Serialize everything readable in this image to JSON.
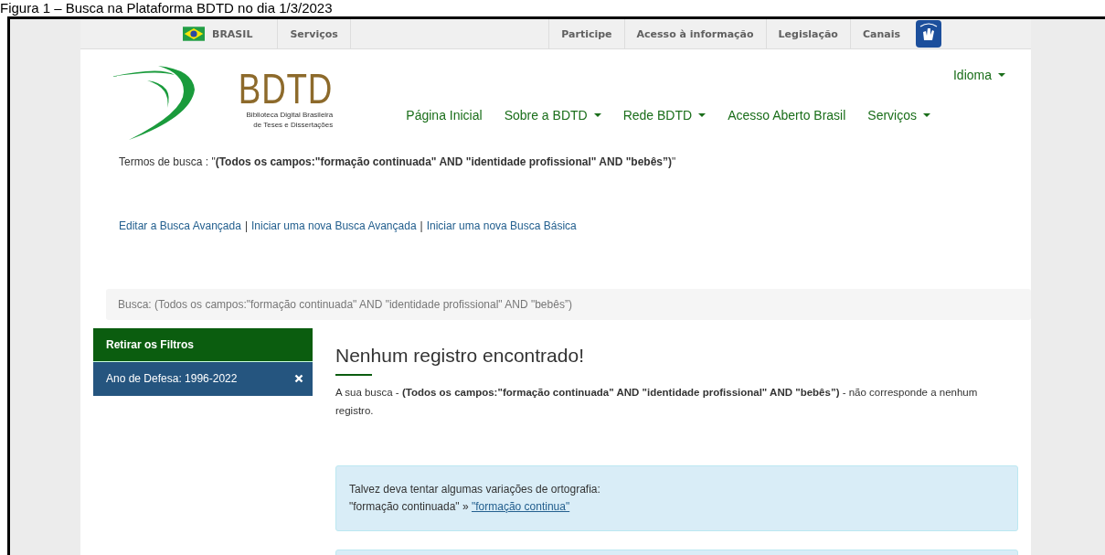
{
  "caption": "Figura 1 – Busca na Plataforma BDTD no dia 1/3/2023",
  "top_bar": {
    "country": "BRASIL",
    "left_links": [
      "Serviços"
    ],
    "right_links": [
      "Participe",
      "Acesso à informação",
      "Legislação",
      "Canais"
    ]
  },
  "logo": {
    "title": "BDTD",
    "subtitle_1": "Biblioteca Digital Brasileira",
    "subtitle_2": "de Teses e Dissertações"
  },
  "language_menu": {
    "label": "Idioma",
    "dropdown": true
  },
  "nav": [
    {
      "label": "Página Inicial",
      "dropdown": false
    },
    {
      "label": "Sobre a BDTD",
      "dropdown": true
    },
    {
      "label": "Rede BDTD",
      "dropdown": true
    },
    {
      "label": "Acesso Aberto Brasil",
      "dropdown": false
    },
    {
      "label": "Serviços",
      "dropdown": true
    }
  ],
  "search_terms": "Termos de busca : \"**(Todos os campos:\"formação continuada\" AND \"identidade profissional\" AND \"bebês”)**\"",
  "search_links": [
    "Editar a Busca Avançada",
    "Iniciar uma nova Busca Avançada",
    "Iniciar uma nova Busca Básica"
  ],
  "link_separator": "|",
  "breadcrumb": "Busca: (Todos os campos:\"formação continuada\" AND \"identidade profissional\" AND \"bebês”)",
  "sidebar": {
    "clear_filters": "Retirar os Filtros",
    "filters": [
      {
        "label": "Ano de Defesa: 1996-2022"
      }
    ]
  },
  "results": {
    "heading": "Nenhum registro encontrado!",
    "message": "A sua busca - **(Todos os campos:\"formação continuada\" AND \"identidade profissional\" AND \"bebês”)** - não corresponde a nenhum registro.",
    "suggestion_intro": "Talvez deva tentar algumas variações de ortografia:",
    "suggestion_original": "\"formação continuada\" »",
    "suggestion_link": "\"formação continua\""
  }
}
